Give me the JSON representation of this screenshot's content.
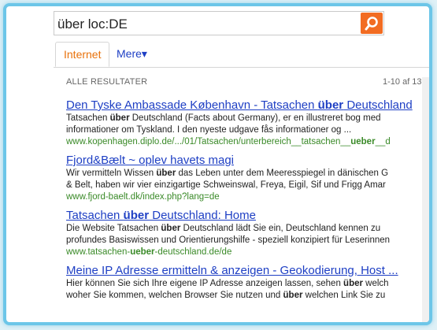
{
  "search": {
    "query": "über loc:DE"
  },
  "tabs": [
    {
      "label": "Internet"
    },
    {
      "label": "Mere▾"
    }
  ],
  "results_header": {
    "label": "ALLE RESULTATER",
    "range": "1-10 af 13."
  },
  "results": [
    {
      "title_pre": "Den Tyske Ambassade København - Tatsachen ",
      "title_bold": "über",
      "title_post": " Deutschland",
      "line1_pre": "Tatsachen ",
      "line1_bold": "über",
      "line1_post": " Deutschland (Facts about Germany), er en illustreret bog med",
      "line2_pre": "informationer om Tyskland. I den nyeste udgave fås informationer og ...",
      "line2_bold": "",
      "line2_post": "",
      "url_pre": "www.kopenhagen.diplo.de/.../01/Tatsachen/unterbereich__tatsachen__",
      "url_bold": "ueber",
      "url_post": "__d"
    },
    {
      "title_pre": "Fjord&Bælt ~ oplev havets magi",
      "title_bold": "",
      "title_post": "",
      "line1_pre": "Wir vermitteln Wissen ",
      "line1_bold": "über",
      "line1_post": " das Leben unter dem Meeresspiegel in dänischen G",
      "line2_pre": "& Belt, haben wir vier einzigartige Schweinswal, Freya, Eigil, Sif und Frigg Amar",
      "line2_bold": "",
      "line2_post": "",
      "url_pre": "www.fjord-baelt.dk/index.php?lang=de",
      "url_bold": "",
      "url_post": ""
    },
    {
      "title_pre": "Tatsachen ",
      "title_bold": "über",
      "title_post": " Deutschland: Home",
      "line1_pre": "Die Website Tatsachen ",
      "line1_bold": "über",
      "line1_post": " Deutschland lädt Sie ein, Deutschland kennen zu",
      "line2_pre": "profundes Basiswissen und Orientierungshilfe - speziell konzipiert für Leserinnen",
      "line2_bold": "",
      "line2_post": "",
      "url_pre": "www.tatsachen-",
      "url_bold": "ueber",
      "url_post": "-deutschland.de/de"
    },
    {
      "title_pre": "Meine IP Adresse ermitteln & anzeigen - Geokodierung, Host ...",
      "title_bold": "",
      "title_post": "",
      "line1_pre": "Hier können Sie sich Ihre eigene IP Adresse anzeigen lassen, sehen ",
      "line1_bold": "über",
      "line1_post": " welch",
      "line2_pre": "woher Sie kommen, welchen Browser Sie nutzen und ",
      "line2_bold": "über",
      "line2_post": " welchen Link Sie zu",
      "url_pre": "",
      "url_bold": "",
      "url_post": ""
    }
  ],
  "colors": {
    "accent": "#f26c22",
    "link": "#1e3fc4",
    "url": "#3a8a28",
    "frame": "#6cc6e8"
  },
  "icons": {
    "search_button": "search-icon"
  }
}
